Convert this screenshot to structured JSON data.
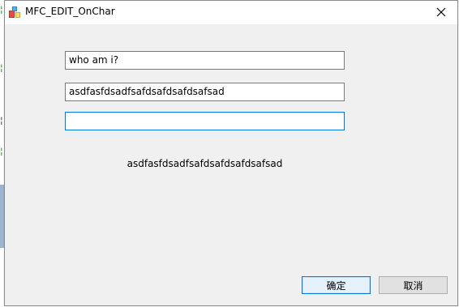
{
  "window": {
    "title": "MFC_EDIT_OnChar"
  },
  "fields": {
    "edit1_value": "who am i?",
    "edit2_value": "asdfasfdsadfsafdsafdsafdsafsad",
    "edit3_value": ""
  },
  "output": {
    "static_text": "asdfasfdsadfsafdsafdsafdsafsad"
  },
  "buttons": {
    "ok_label": "确定",
    "cancel_label": "取消"
  },
  "colors": {
    "dialog_bg": "#f0f0f0",
    "focus_border": "#0078d7",
    "default_button_bg": "#e5f1fb"
  },
  "icons": {
    "app": "mfc-app-icon",
    "close": "close-icon"
  }
}
